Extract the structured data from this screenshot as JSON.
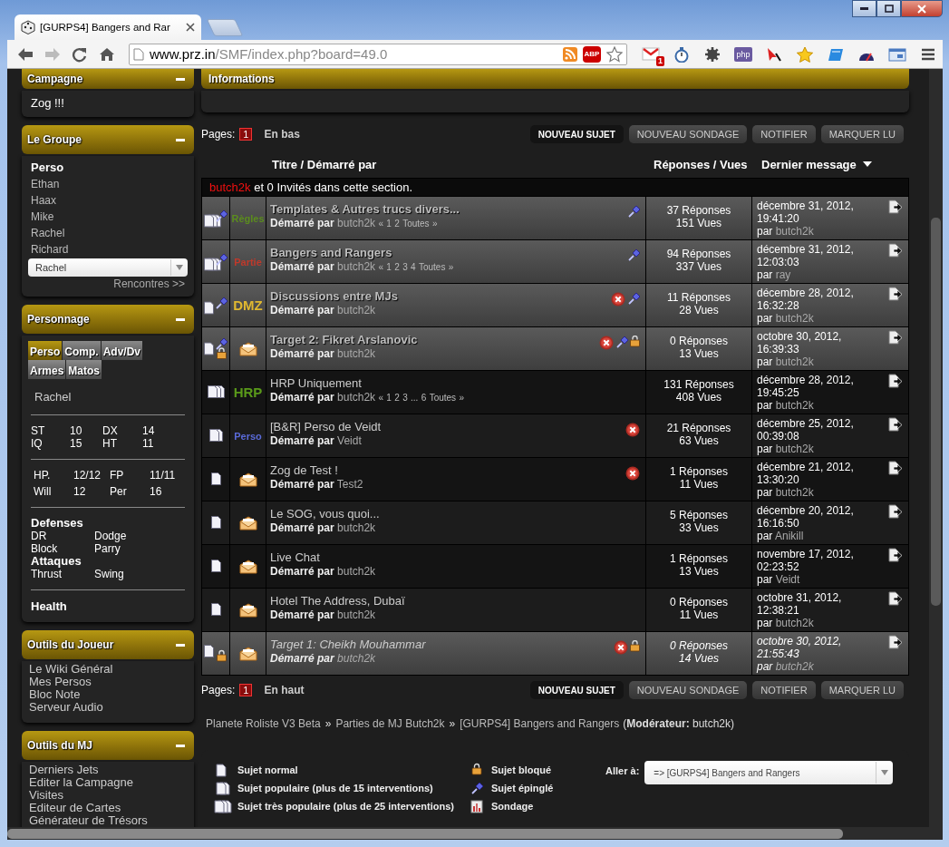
{
  "browser": {
    "tabs": [
      {
        "title": "[GURPS4] Bangers and Rar",
        "selected": true
      }
    ],
    "url_host": "www.prz.in",
    "url_path": "/SMF/index.php?board=49.0",
    "adblock_label": "ABP",
    "mail_badge": "1",
    "php_label": "php"
  },
  "sidebar": [
    {
      "kind": "text",
      "title": "Campagne",
      "lines": [
        "Zog !!!"
      ]
    },
    {
      "kind": "group",
      "title": "Le Groupe",
      "heading": "Perso",
      "members": [
        "Ethan",
        "Haax",
        "Mike",
        "Rachel",
        "Richard"
      ],
      "select": "Rachel",
      "link": "Rencontres >>"
    },
    {
      "kind": "character",
      "title": "Personnage",
      "tabs": [
        {
          "label": "Perso",
          "selected": true
        },
        {
          "label": "Comp.",
          "selected": false
        },
        {
          "label": "Adv/Dv",
          "selected": false
        },
        {
          "label": "Armes",
          "selected": false
        },
        {
          "label": "Matos",
          "selected": false
        }
      ],
      "name": "Rachel",
      "blocks": [
        {
          "kind": "grid",
          "rows": [
            [
              "ST",
              "10",
              "DX",
              "14"
            ],
            [
              "IQ",
              "15",
              "HT",
              "11"
            ]
          ]
        },
        {
          "kind": "grid",
          "rows": [
            [
              "HP.",
              "12/12",
              "FP",
              "11/11"
            ],
            [
              "Will",
              "12",
              "Per",
              "16"
            ]
          ]
        },
        {
          "kind": "pairs",
          "groups": [
            {
              "heading": "Defenses",
              "rows": [
                [
                  "DR",
                  "Dodge"
                ],
                [
                  "Block",
                  "Parry"
                ]
              ]
            },
            {
              "heading": "Attaques",
              "rows": [
                [
                  "Thrust",
                  "Swing"
                ]
              ]
            }
          ]
        },
        {
          "kind": "heading",
          "text": "Health"
        }
      ]
    },
    {
      "kind": "links",
      "title": "Outils du Joueur",
      "links": [
        "Le Wiki Général",
        "Mes Persos",
        "Bloc Note",
        "Serveur Audio"
      ]
    },
    {
      "kind": "links",
      "title": "Outils du MJ",
      "links": [
        "Derniers Jets",
        "Editer la Campagne",
        "Visites",
        "Editeur de Cartes",
        "Générateur de Trésors"
      ]
    }
  ],
  "information": {
    "title": "Informations"
  },
  "top_bar": {
    "pages_label": "Pages:",
    "current_page": "1",
    "jump": "En bas",
    "buttons": [
      {
        "label": "NOUVEAU SUJET",
        "primary": true
      },
      {
        "label": "NOUVEAU SONDAGE",
        "primary": false
      },
      {
        "label": "NOTIFIER",
        "primary": false
      },
      {
        "label": "MARQUER LU",
        "primary": false
      }
    ]
  },
  "columns": [
    {
      "label": "Titre / Démarré par",
      "sorted": false
    },
    {
      "label": "Réponses / Vues",
      "sorted": false
    },
    {
      "label": "Dernier message",
      "sorted": true
    }
  ],
  "viewers": {
    "user": "butch2k",
    "text": "et 0 Invités dans cette section."
  },
  "topics": [
    {
      "kind": "very_hot",
      "sticky": true,
      "locked": false,
      "cross": false,
      "unapproved": false,
      "prefix": {
        "kind": "label",
        "text": "Règles",
        "color": "#5b8c1e",
        "large": false
      },
      "title": "Templates & Autres trucs divers...",
      "started_label": "Démarré par",
      "starter": "butch2k",
      "pager": {
        "open": "«",
        "pages": [
          "1",
          "2"
        ],
        "all": "Toutes",
        "close": "»"
      },
      "replies": "37 Réponses",
      "views": "151 Vues",
      "last_date": "décembre 31, 2012,",
      "last_time": "19:41:20",
      "last_by_label": "par",
      "last_by": "butch2k"
    },
    {
      "kind": "very_hot",
      "sticky": true,
      "locked": false,
      "cross": false,
      "unapproved": false,
      "prefix": {
        "kind": "label",
        "text": "Partie",
        "color": "#c0392b",
        "large": false
      },
      "title": "Bangers and Rangers",
      "started_label": "Démarré par",
      "starter": "butch2k",
      "pager": {
        "open": "«",
        "pages": [
          "1",
          "2",
          "3",
          "4"
        ],
        "all": "Toutes",
        "close": "»"
      },
      "replies": "94 Réponses",
      "views": "337 Vues",
      "last_date": "décembre 31, 2012,",
      "last_time": "12:03:03",
      "last_by_label": "par",
      "last_by": "ray"
    },
    {
      "kind": "normal",
      "sticky": true,
      "locked": false,
      "cross": true,
      "unapproved": false,
      "prefix": {
        "kind": "label",
        "text": "DMZ",
        "color": "#e0b830",
        "large": true
      },
      "title": "Discussions entre MJs",
      "started_label": "Démarré par",
      "starter": "butch2k",
      "replies": "11 Réponses",
      "views": "28 Vues",
      "last_date": "décembre 28, 2012,",
      "last_time": "16:32:28",
      "last_by_label": "par",
      "last_by": "butch2k"
    },
    {
      "kind": "normal",
      "sticky": true,
      "locked": true,
      "cross": true,
      "unapproved": false,
      "prefix": {
        "kind": "envelope"
      },
      "title": "Target 2: Fikret Arslanovic",
      "started_label": "Démarré par",
      "starter": "butch2k",
      "replies": "0 Réponses",
      "views": "13 Vues",
      "last_date": "octobre 30, 2012,",
      "last_time": "16:39:33",
      "last_by_label": "par",
      "last_by": "butch2k"
    },
    {
      "kind": "very_hot",
      "sticky": false,
      "locked": false,
      "cross": false,
      "unapproved": false,
      "prefix": {
        "kind": "label",
        "text": "HRP",
        "color": "#5a9a1a",
        "large": true
      },
      "title": "HRP Uniquement",
      "started_label": "Démarré par",
      "starter": "butch2k",
      "pager": {
        "open": "«",
        "pages": [
          "1",
          "2",
          "3",
          "...",
          "6"
        ],
        "all": "Toutes",
        "close": "»"
      },
      "replies": "131 Réponses",
      "views": "408 Vues",
      "last_date": "décembre 28, 2012,",
      "last_time": "19:45:25",
      "last_by_label": "par",
      "last_by": "butch2k"
    },
    {
      "kind": "hot",
      "sticky": false,
      "locked": false,
      "cross": true,
      "unapproved": false,
      "prefix": {
        "kind": "label",
        "text": "Perso",
        "color": "#5a6ad8",
        "large": false
      },
      "title": "[B&R] Perso de Veidt",
      "started_label": "Démarré par",
      "starter": "Veidt",
      "replies": "21 Réponses",
      "views": "63 Vues",
      "last_date": "décembre 25, 2012,",
      "last_time": "00:39:08",
      "last_by_label": "par",
      "last_by": "butch2k"
    },
    {
      "kind": "normal",
      "sticky": false,
      "locked": false,
      "cross": true,
      "unapproved": false,
      "prefix": {
        "kind": "envelope"
      },
      "title": "Zog de Test !",
      "started_label": "Démarré par",
      "starter": "Test2",
      "replies": "1 Réponses",
      "views": "11 Vues",
      "last_date": "décembre 21, 2012,",
      "last_time": "13:30:20",
      "last_by_label": "par",
      "last_by": "butch2k"
    },
    {
      "kind": "normal",
      "sticky": false,
      "locked": false,
      "cross": false,
      "unapproved": false,
      "prefix": {
        "kind": "envelope"
      },
      "title": "Le SOG, vous quoi...",
      "started_label": "Démarré par",
      "starter": "butch2k",
      "replies": "5 Réponses",
      "views": "33 Vues",
      "last_date": "décembre 20, 2012,",
      "last_time": "16:16:50",
      "last_by_label": "par",
      "last_by": "Anikill"
    },
    {
      "kind": "normal",
      "sticky": false,
      "locked": false,
      "cross": false,
      "unapproved": false,
      "prefix": {
        "kind": "envelope"
      },
      "title": "Live Chat",
      "started_label": "Démarré par",
      "starter": "butch2k",
      "replies": "1 Réponses",
      "views": "13 Vues",
      "last_date": "novembre 17, 2012,",
      "last_time": "02:23:52",
      "last_by_label": "par",
      "last_by": "Veidt"
    },
    {
      "kind": "normal",
      "sticky": false,
      "locked": false,
      "cross": false,
      "unapproved": false,
      "prefix": {
        "kind": "envelope"
      },
      "title": "Hotel The Address, Dubaï",
      "started_label": "Démarré par",
      "starter": "butch2k",
      "replies": "0 Réponses",
      "views": "11 Vues",
      "last_date": "octobre 31, 2012,",
      "last_time": "12:38:21",
      "last_by_label": "par",
      "last_by": "butch2k"
    },
    {
      "kind": "normal",
      "sticky": false,
      "locked": true,
      "cross": true,
      "unapproved": true,
      "prefix": {
        "kind": "envelope"
      },
      "title": "Target 1: Cheikh Mouhammar",
      "started_label": "Démarré par",
      "starter": "butch2k",
      "replies": "0 Réponses",
      "views": "14 Vues",
      "last_date": "octobre 30, 2012,",
      "last_time": "21:55:43",
      "last_by_label": "par",
      "last_by": "butch2k"
    }
  ],
  "bottom_bar": {
    "pages_label": "Pages:",
    "current_page": "1",
    "jump": "En haut",
    "buttons": [
      {
        "label": "NOUVEAU SUJET",
        "primary": true
      },
      {
        "label": "NOUVEAU SONDAGE",
        "primary": false
      },
      {
        "label": "NOTIFIER",
        "primary": false
      },
      {
        "label": "MARQUER LU",
        "primary": false
      }
    ]
  },
  "breadcrumb": [
    {
      "label": "Planete Roliste V3 Beta",
      "separator": "»"
    },
    {
      "label": "Parties de MJ Butch2k",
      "separator": "»"
    },
    {
      "label": "[GURPS4] Bangers and Rangers"
    }
  ],
  "moderator": "(**Modérateur:** butch2k)",
  "legend": [
    [
      {
        "kind": "normal",
        "text": "Sujet normal"
      },
      {
        "kind": "hot",
        "text": "Sujet populaire (plus de 15 interventions)"
      },
      {
        "kind": "very_hot",
        "text": "Sujet très populaire (plus de 25 interventions)"
      }
    ],
    [
      {
        "kind": "lock",
        "text": "Sujet bloqué"
      },
      {
        "kind": "pin",
        "text": "Sujet épinglé"
      },
      {
        "kind": "poll",
        "text": "Sondage"
      }
    ]
  ],
  "jump_to": {
    "label": "Aller à:",
    "value": "=> [GURPS4] Bangers and Rangers"
  }
}
